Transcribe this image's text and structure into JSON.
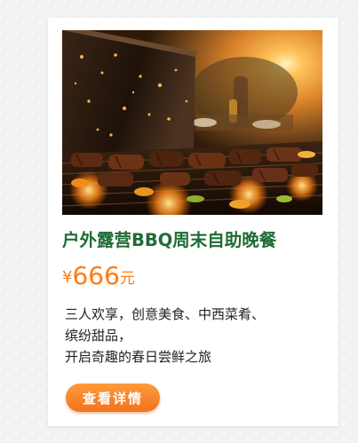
{
  "card": {
    "image_alt": "BBQ grill",
    "title": "户外露营BBQ周末自助晚餐",
    "price": {
      "currency": "¥",
      "amount": "666",
      "unit": "元"
    },
    "description_lines": [
      "三人欢享，创意美食、中西菜肴、",
      "缤纷甜品，",
      "开启奇趣的春日尝鲜之旅"
    ],
    "button_label": "查看详情"
  },
  "colors": {
    "title": "#1f6b34",
    "price": "#ff7a12",
    "button": "#f57d22"
  }
}
